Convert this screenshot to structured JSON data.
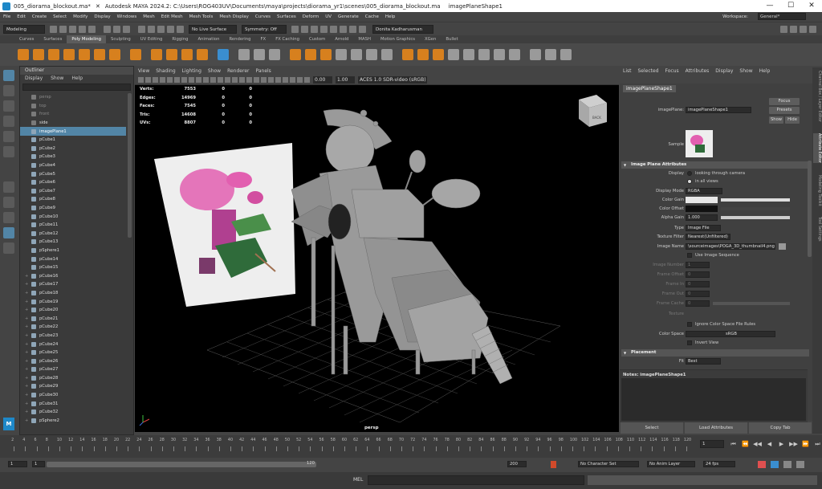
{
  "titlebar": {
    "tab1": "005_diorama_blockout.ma*",
    "title": "Autodesk MAYA 2024.2: C:\\Users\\ROG403UV\\Documents\\maya\\projects\\diorama_yr1\\scenes\\005_diorama_blockout.ma",
    "tab2": "imagePlaneShape1",
    "min": "—",
    "max": "☐",
    "close": "✕"
  },
  "menubar": {
    "items": [
      "File",
      "Edit",
      "Create",
      "Select",
      "Modify",
      "Display",
      "Windows",
      "Mesh",
      "Edit Mesh",
      "Mesh Tools",
      "Mesh Display",
      "Curves",
      "Surfaces",
      "Deform",
      "UV",
      "Generate",
      "Cache",
      "Help"
    ],
    "workspace_label": "Workspace:",
    "workspace_value": "General*"
  },
  "statusline": {
    "mode": "Modeling",
    "live_surface": "No Live Surface",
    "symmetry": "Symmetry: Off",
    "user": "Donita Kadharusman"
  },
  "shelf_tabs": [
    "Curves",
    "Surfaces",
    "Poly Modeling",
    "Sculpting",
    "UV Editing",
    "Rigging",
    "Animation",
    "Rendering",
    "FX",
    "FX Caching",
    "Custom",
    "Arnold",
    "MASH",
    "Motion Graphics",
    "XGen",
    "Bullet"
  ],
  "shelf_active": "Poly Modeling",
  "outliner": {
    "title": "Outliner",
    "menu": [
      "Display",
      "Show",
      "Help"
    ],
    "items": [
      {
        "name": "persp",
        "state": "dim"
      },
      {
        "name": "top",
        "state": "dim"
      },
      {
        "name": "front",
        "state": "dim"
      },
      {
        "name": "side",
        "state": "normal"
      },
      {
        "name": "imagePlane1",
        "state": "selected"
      },
      {
        "name": "pCube1"
      },
      {
        "name": "pCube2"
      },
      {
        "name": "pCube3"
      },
      {
        "name": "pCube4"
      },
      {
        "name": "pCube5"
      },
      {
        "name": "pCube6"
      },
      {
        "name": "pCube7"
      },
      {
        "name": "pCube8"
      },
      {
        "name": "pCube9"
      },
      {
        "name": "pCube10"
      },
      {
        "name": "pCube11"
      },
      {
        "name": "pCube12"
      },
      {
        "name": "pCube13"
      },
      {
        "name": "pSphere1"
      },
      {
        "name": "pCube14"
      },
      {
        "name": "pCube15"
      },
      {
        "name": "pCube16",
        "expand": true
      },
      {
        "name": "pCube17",
        "expand": true
      },
      {
        "name": "pCube18",
        "expand": true
      },
      {
        "name": "pCube19",
        "expand": true
      },
      {
        "name": "pCube20",
        "expand": true
      },
      {
        "name": "pCube21",
        "expand": true
      },
      {
        "name": "pCube22",
        "expand": true
      },
      {
        "name": "pCube23",
        "expand": true
      },
      {
        "name": "pCube24",
        "expand": true
      },
      {
        "name": "pCube25",
        "expand": true
      },
      {
        "name": "pCube26",
        "expand": true
      },
      {
        "name": "pCube27",
        "expand": true
      },
      {
        "name": "pCube28",
        "expand": true
      },
      {
        "name": "pCube29",
        "expand": true
      },
      {
        "name": "pCube30",
        "expand": true
      },
      {
        "name": "pCube31",
        "expand": true
      },
      {
        "name": "pCube32",
        "expand": true
      },
      {
        "name": "pSphere2",
        "expand": true
      }
    ]
  },
  "logo_letter": "M",
  "viewport": {
    "menu": [
      "View",
      "Shading",
      "Lighting",
      "Show",
      "Renderer",
      "Panels"
    ],
    "exposure": "0.00",
    "gamma": "1.00",
    "colorspace": "ACES 1.0 SDR-video (sRGB)",
    "hud": [
      {
        "label": "Verts:",
        "a": "7553",
        "b": "0",
        "c": "0"
      },
      {
        "label": "Edges:",
        "a": "14969",
        "b": "0",
        "c": "0"
      },
      {
        "label": "Faces:",
        "a": "7545",
        "b": "0",
        "c": "0"
      },
      {
        "label": "Tris:",
        "a": "14608",
        "b": "0",
        "c": "0"
      },
      {
        "label": "UVs:",
        "a": "8807",
        "b": "0",
        "c": "0"
      }
    ],
    "camera": "persp",
    "viewcube_label": "BACK"
  },
  "ae": {
    "menu": [
      "List",
      "Selected",
      "Focus",
      "Attributes",
      "Display",
      "Show",
      "Help"
    ],
    "tab": "imagePlaneShape1",
    "node_label": "imagePlane:",
    "node_value": "imagePlaneShape1",
    "focus": "Focus",
    "presets": "Presets",
    "show": "Show",
    "hide": "Hide",
    "sample": "Sample",
    "section_image_plane": "Image Plane Attributes",
    "display_label": "Display",
    "display_opt1": "looking through camera",
    "display_opt2": "in all views",
    "display_mode_label": "Display Mode",
    "display_mode_value": "RGBA",
    "color_gain": "Color Gain",
    "color_offset": "Color Offset",
    "alpha_gain": "Alpha Gain",
    "alpha_gain_value": "1.000",
    "type_label": "Type",
    "type_value": "Image File",
    "texture_filter_label": "Texture Filter",
    "texture_filter_value": "Nearest(Unfiltered)",
    "image_name_label": "Image Name",
    "image_name_value": "\\sourceimages\\POGA_3D_thumbnail4.png",
    "use_image_sequence": "Use Image Sequence",
    "image_number": "Image Number",
    "image_number_value": "1",
    "frame_offset": "Frame Offset",
    "frame_offset_value": "0",
    "frame_in": "Frame In",
    "frame_in_value": "0",
    "frame_out": "Frame Out",
    "frame_out_value": "0",
    "frame_cache": "Frame Cache",
    "frame_cache_value": "0",
    "texture": "Texture",
    "ignore_cs": "Ignore Color Space File Rules",
    "color_space_label": "Color Space",
    "color_space_value": "sRGB",
    "invert_view": "Invert View",
    "section_placement": "Placement",
    "fit_label": "Fit",
    "fit_value": "Best",
    "notes": "Notes: imagePlaneShape1",
    "btn_select": "Select",
    "btn_load": "Load Attributes",
    "btn_copy": "Copy Tab"
  },
  "side_tabs": [
    "Channel Box / Layer Editor",
    "Attribute Editor",
    "Modeling Toolkit",
    "Tool Settings"
  ],
  "side_tab_active": "Attribute Editor",
  "timeline": {
    "tick_labels": [
      "2",
      "4",
      "6",
      "8",
      "10",
      "12",
      "14",
      "16",
      "18",
      "20",
      "22",
      "24",
      "26",
      "28",
      "30",
      "32",
      "34",
      "36",
      "38",
      "40",
      "42",
      "44",
      "46",
      "48",
      "50",
      "52",
      "54",
      "56",
      "58",
      "60",
      "62",
      "64",
      "66",
      "68",
      "70",
      "72",
      "74",
      "76",
      "78",
      "80",
      "82",
      "84",
      "86",
      "88",
      "90",
      "92",
      "94",
      "96",
      "98",
      "100",
      "102",
      "104",
      "106",
      "108",
      "110",
      "112",
      "114",
      "116",
      "118",
      "120"
    ],
    "current_frame": "1",
    "playback": [
      "⏮",
      "⏪",
      "◀◀",
      "◀",
      "▶",
      "▶▶",
      "⏩",
      "⏭"
    ]
  },
  "range": {
    "start": "1",
    "inner_start": "1",
    "inner_end": "120",
    "end": "200",
    "character_set": "No Character Set",
    "anim_layer": "No Anim Layer",
    "fps": "24 fps"
  },
  "cmdline": {
    "label": "MEL"
  },
  "colors": {
    "accent": "#5285a6",
    "shelf_orange": "#d7801e",
    "maya_blue": "#1e88c8"
  }
}
